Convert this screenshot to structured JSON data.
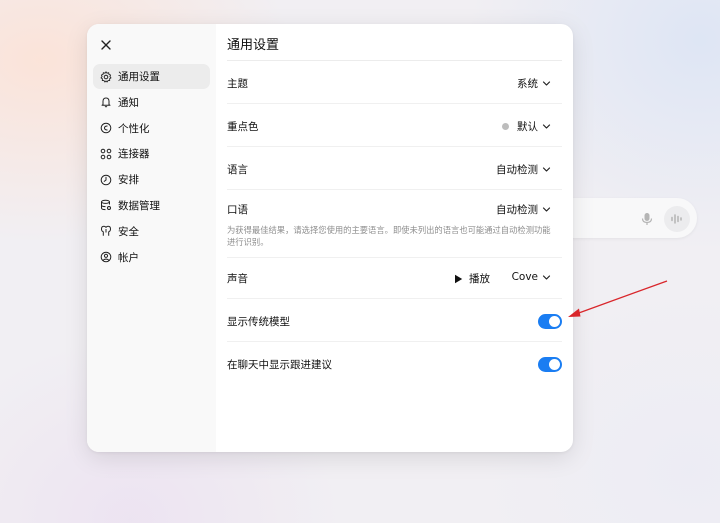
{
  "colors": {
    "accent": "#1a7df2",
    "annotation": "#d9262b",
    "sidebar_bg": "#f9f9f9",
    "active_nav_bg": "#ececec"
  },
  "sidebar": {
    "close_icon": "close-icon",
    "items": [
      {
        "label": "通用设置",
        "icon": "gear-icon",
        "active": true
      },
      {
        "label": "通知",
        "icon": "bell-icon"
      },
      {
        "label": "个性化",
        "icon": "personalize-icon"
      },
      {
        "label": "连接器",
        "icon": "connectors-icon"
      },
      {
        "label": "安排",
        "icon": "clock-icon"
      },
      {
        "label": "数据管理",
        "icon": "database-icon"
      },
      {
        "label": "安全",
        "icon": "shield-icon"
      },
      {
        "label": "帐户",
        "icon": "account-icon"
      }
    ]
  },
  "main": {
    "title": "通用设置",
    "theme": {
      "label": "主题",
      "value": "系统"
    },
    "accent_color": {
      "label": "重点色",
      "value": "默认"
    },
    "language": {
      "label": "语言",
      "value": "自动检测"
    },
    "spoken_language": {
      "label": "口语",
      "value": "自动检测",
      "hint": "为获得最佳结果，请选择您使用的主要语言。即使未列出的语言也可能通过自动检测功能进行识别。"
    },
    "voice": {
      "label": "声音",
      "play_label": "播放",
      "value": "Cove"
    },
    "show_legacy_models": {
      "label": "显示传统模型",
      "enabled": true
    },
    "follow_up_suggestions": {
      "label": "在聊天中显示跟进建议",
      "enabled": true
    }
  }
}
